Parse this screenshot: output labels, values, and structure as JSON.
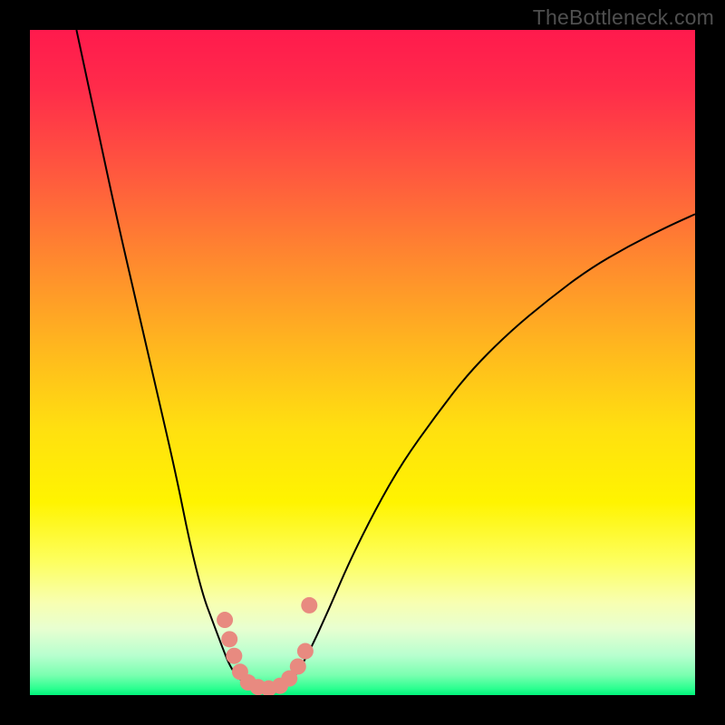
{
  "watermark": "TheBottleneck.com",
  "colors": {
    "frame": "#000000",
    "curve": "#000000",
    "marker_fill": "#e88a80",
    "marker_stroke": "#d07066",
    "gradient_top": "#ff1a4d",
    "gradient_bottom": "#00f37a"
  },
  "chart_data": {
    "type": "line",
    "title": "",
    "xlabel": "",
    "ylabel": "",
    "xlim": [
      0,
      100
    ],
    "ylim": [
      0,
      100
    ],
    "grid": false,
    "legend": false,
    "note": "x and y are in percent of plot width/height; y=0 at bottom. Values estimated from pixels (no axis ticks are rendered).",
    "series": [
      {
        "name": "left-branch",
        "x": [
          7.0,
          10.0,
          13.0,
          16.0,
          19.0,
          22.0,
          24.0,
          26.0,
          27.5,
          29.0,
          30.0,
          31.0,
          32.0,
          33.5
        ],
        "y": [
          100.0,
          86.0,
          72.0,
          59.0,
          46.0,
          33.0,
          23.0,
          15.0,
          11.0,
          7.0,
          4.5,
          3.0,
          2.0,
          1.3
        ]
      },
      {
        "name": "right-branch",
        "x": [
          38.5,
          40.0,
          42.0,
          45.0,
          48.0,
          52.0,
          56.0,
          61.0,
          66.0,
          72.0,
          78.0,
          84.0,
          90.0,
          96.0,
          100.0
        ],
        "y": [
          1.5,
          3.0,
          6.5,
          13.0,
          20.0,
          28.0,
          35.0,
          42.0,
          48.5,
          54.5,
          59.5,
          64.0,
          67.5,
          70.5,
          72.3
        ]
      },
      {
        "name": "valley-floor",
        "x": [
          33.5,
          35.0,
          36.5,
          38.5
        ],
        "y": [
          1.3,
          1.0,
          1.0,
          1.5
        ]
      }
    ],
    "markers": {
      "name": "highlight-dots",
      "points": [
        {
          "x": 29.3,
          "y": 11.3
        },
        {
          "x": 30.0,
          "y": 8.4
        },
        {
          "x": 30.7,
          "y": 5.9
        },
        {
          "x": 31.6,
          "y": 3.5
        },
        {
          "x": 32.8,
          "y": 1.9
        },
        {
          "x": 34.3,
          "y": 1.2
        },
        {
          "x": 35.9,
          "y": 1.0
        },
        {
          "x": 37.6,
          "y": 1.4
        },
        {
          "x": 39.0,
          "y": 2.5
        },
        {
          "x": 40.3,
          "y": 4.3
        },
        {
          "x": 41.4,
          "y": 6.6
        },
        {
          "x": 42.0,
          "y": 13.5
        }
      ]
    }
  }
}
